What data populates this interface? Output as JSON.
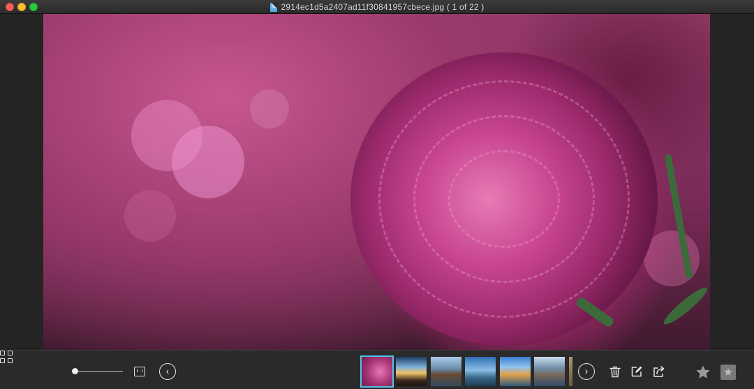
{
  "window": {
    "title": "2914ec1d5a2407ad11f30841957cbece.jpg ( 1 of 22 )"
  },
  "icons": {
    "file": "document-icon",
    "grid": "grid-view-icon",
    "fit": "fit-to-window-icon",
    "prev": "chevron-left-icon",
    "next": "chevron-right-icon",
    "trash": "trash-icon",
    "edit": "edit-icon",
    "share": "share-icon",
    "star": "star-icon",
    "star_box": "star-box-icon"
  },
  "toolbar": {
    "prev_glyph": "‹",
    "next_glyph": "›",
    "zoom_level": 0
  },
  "thumbnails": [
    {
      "name": "pink flower",
      "selected": true
    },
    {
      "name": "sunset landscape",
      "selected": false
    },
    {
      "name": "lake house",
      "selected": false
    },
    {
      "name": "blue sky landscape",
      "selected": false
    },
    {
      "name": "coastal village",
      "selected": false
    },
    {
      "name": "mountain lake",
      "selected": false
    },
    {
      "name": "partial thumbnail",
      "selected": false
    }
  ],
  "colors": {
    "selection_accent": "#52c3ea",
    "toolbar_bg": "#2a2a2a"
  }
}
